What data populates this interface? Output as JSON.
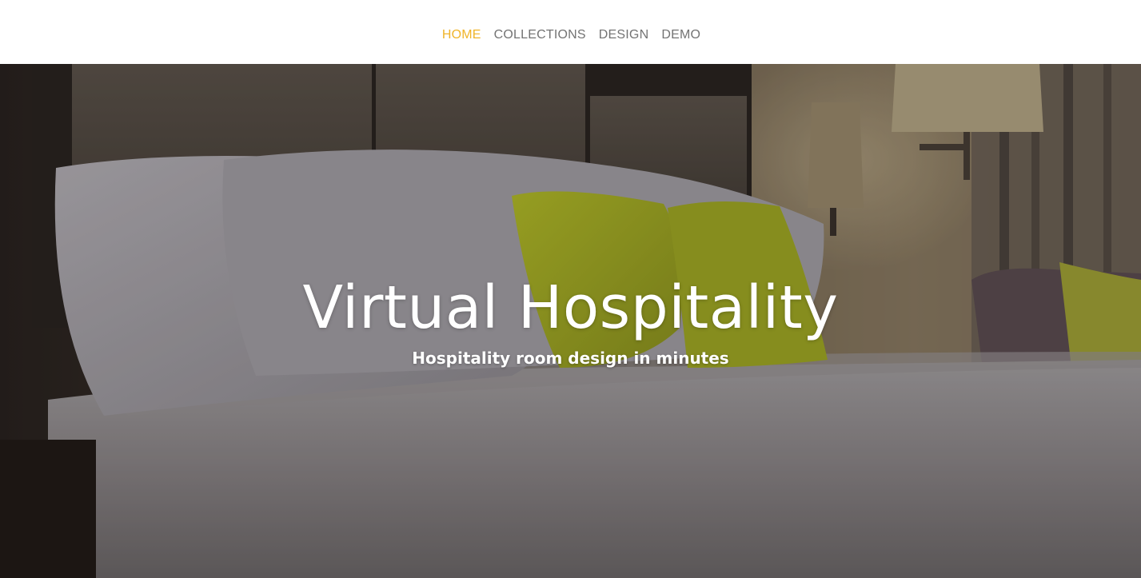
{
  "nav": {
    "items": [
      {
        "label": "HOME",
        "active": true
      },
      {
        "label": "COLLECTIONS",
        "active": false
      },
      {
        "label": "DESIGN",
        "active": false
      },
      {
        "label": "DEMO",
        "active": false
      }
    ],
    "active_color": "#f0b429",
    "text_color": "#737373"
  },
  "hero": {
    "title": "Virtual Hospitality",
    "subtitle": "Hospitality room design in minutes",
    "image": "hotel-bed-photo",
    "accent_pillow_color": "#b7c02a"
  }
}
